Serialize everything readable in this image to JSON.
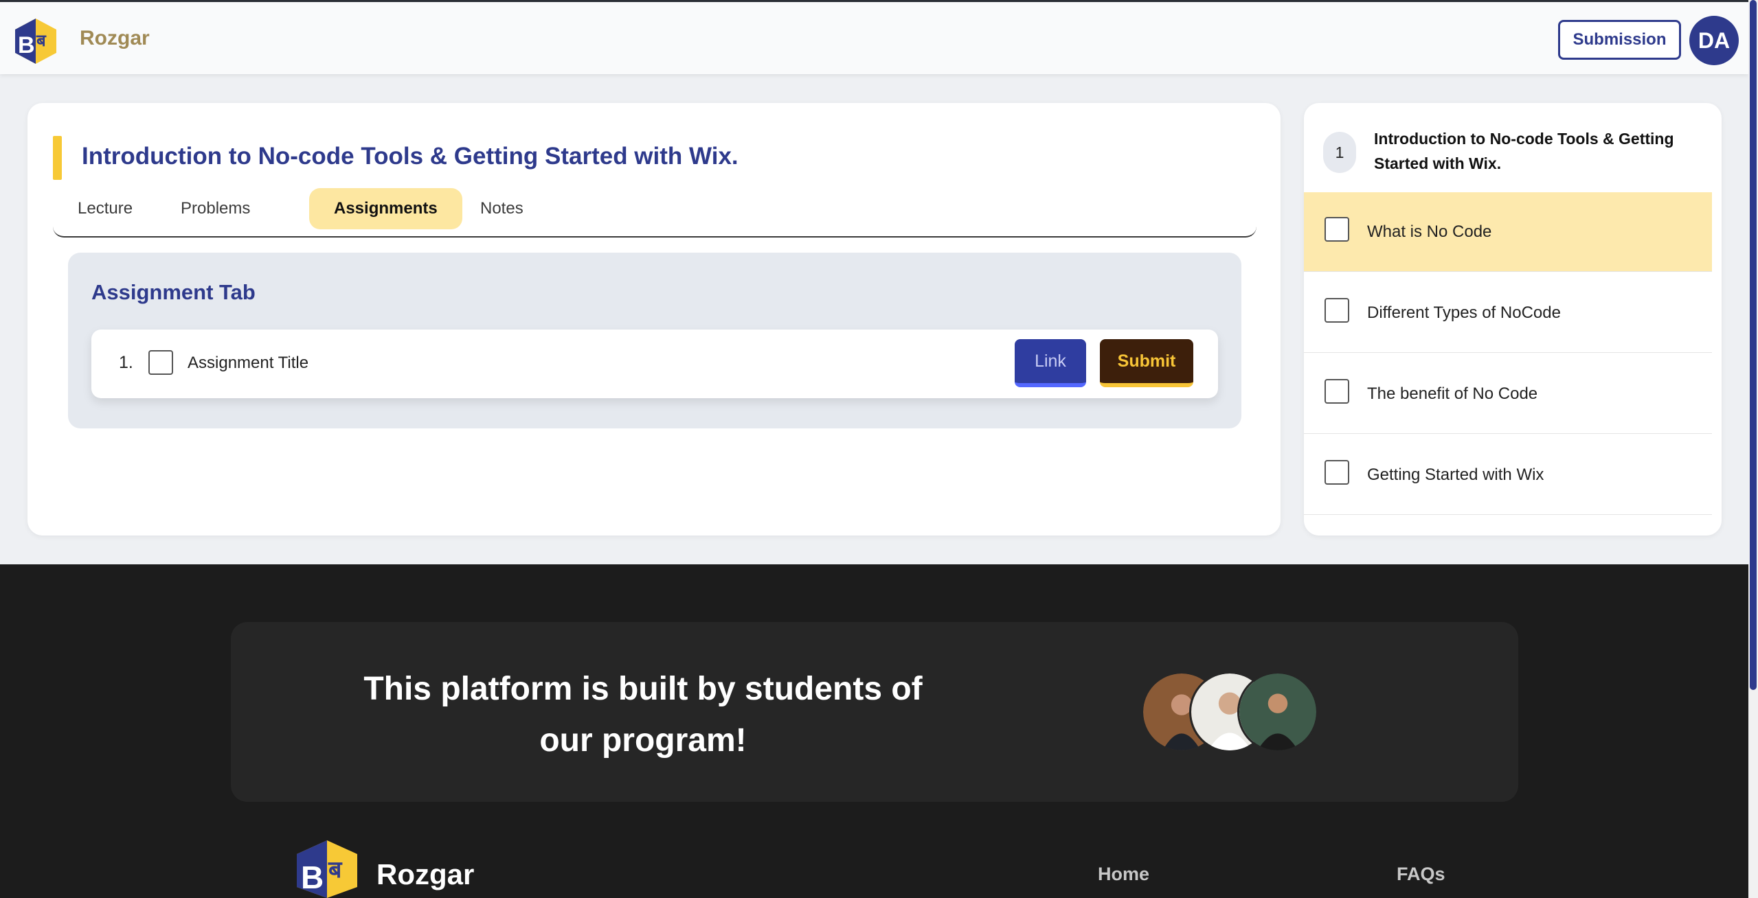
{
  "header": {
    "brand": "Rozgar",
    "submission_label": "Submission",
    "avatar_initials": "DA"
  },
  "lesson": {
    "title": "Introduction to No-code Tools & Getting Started with Wix.",
    "tabs": [
      {
        "label": "Lecture",
        "active": false
      },
      {
        "label": "Problems",
        "active": false
      },
      {
        "label": "Assignments",
        "active": true
      },
      {
        "label": "Notes",
        "active": false
      }
    ]
  },
  "assignments": {
    "heading": "Assignment Tab",
    "items": [
      {
        "number": "1.",
        "title": "Assignment Title",
        "link_label": "Link",
        "submit_label": "Submit"
      }
    ]
  },
  "sidebar": {
    "module_number": "1",
    "module_title": "Introduction to No-code Tools & Getting Started with Wix.",
    "items": [
      {
        "label": "What is No Code",
        "active": true
      },
      {
        "label": "Different Types of NoCode",
        "active": false
      },
      {
        "label": "The benefit of No Code",
        "active": false
      },
      {
        "label": "Getting Started with Wix",
        "active": false
      }
    ]
  },
  "footer": {
    "promo_text": "This platform is built by students of our program!",
    "brand": "Rozgar",
    "links": [
      "Home",
      "FAQs"
    ]
  },
  "colors": {
    "primary": "#2e3a8c",
    "accent_yellow": "#f7c936",
    "active_tab_bg": "#fde7a1",
    "footer_bg": "#1c1c1c"
  }
}
